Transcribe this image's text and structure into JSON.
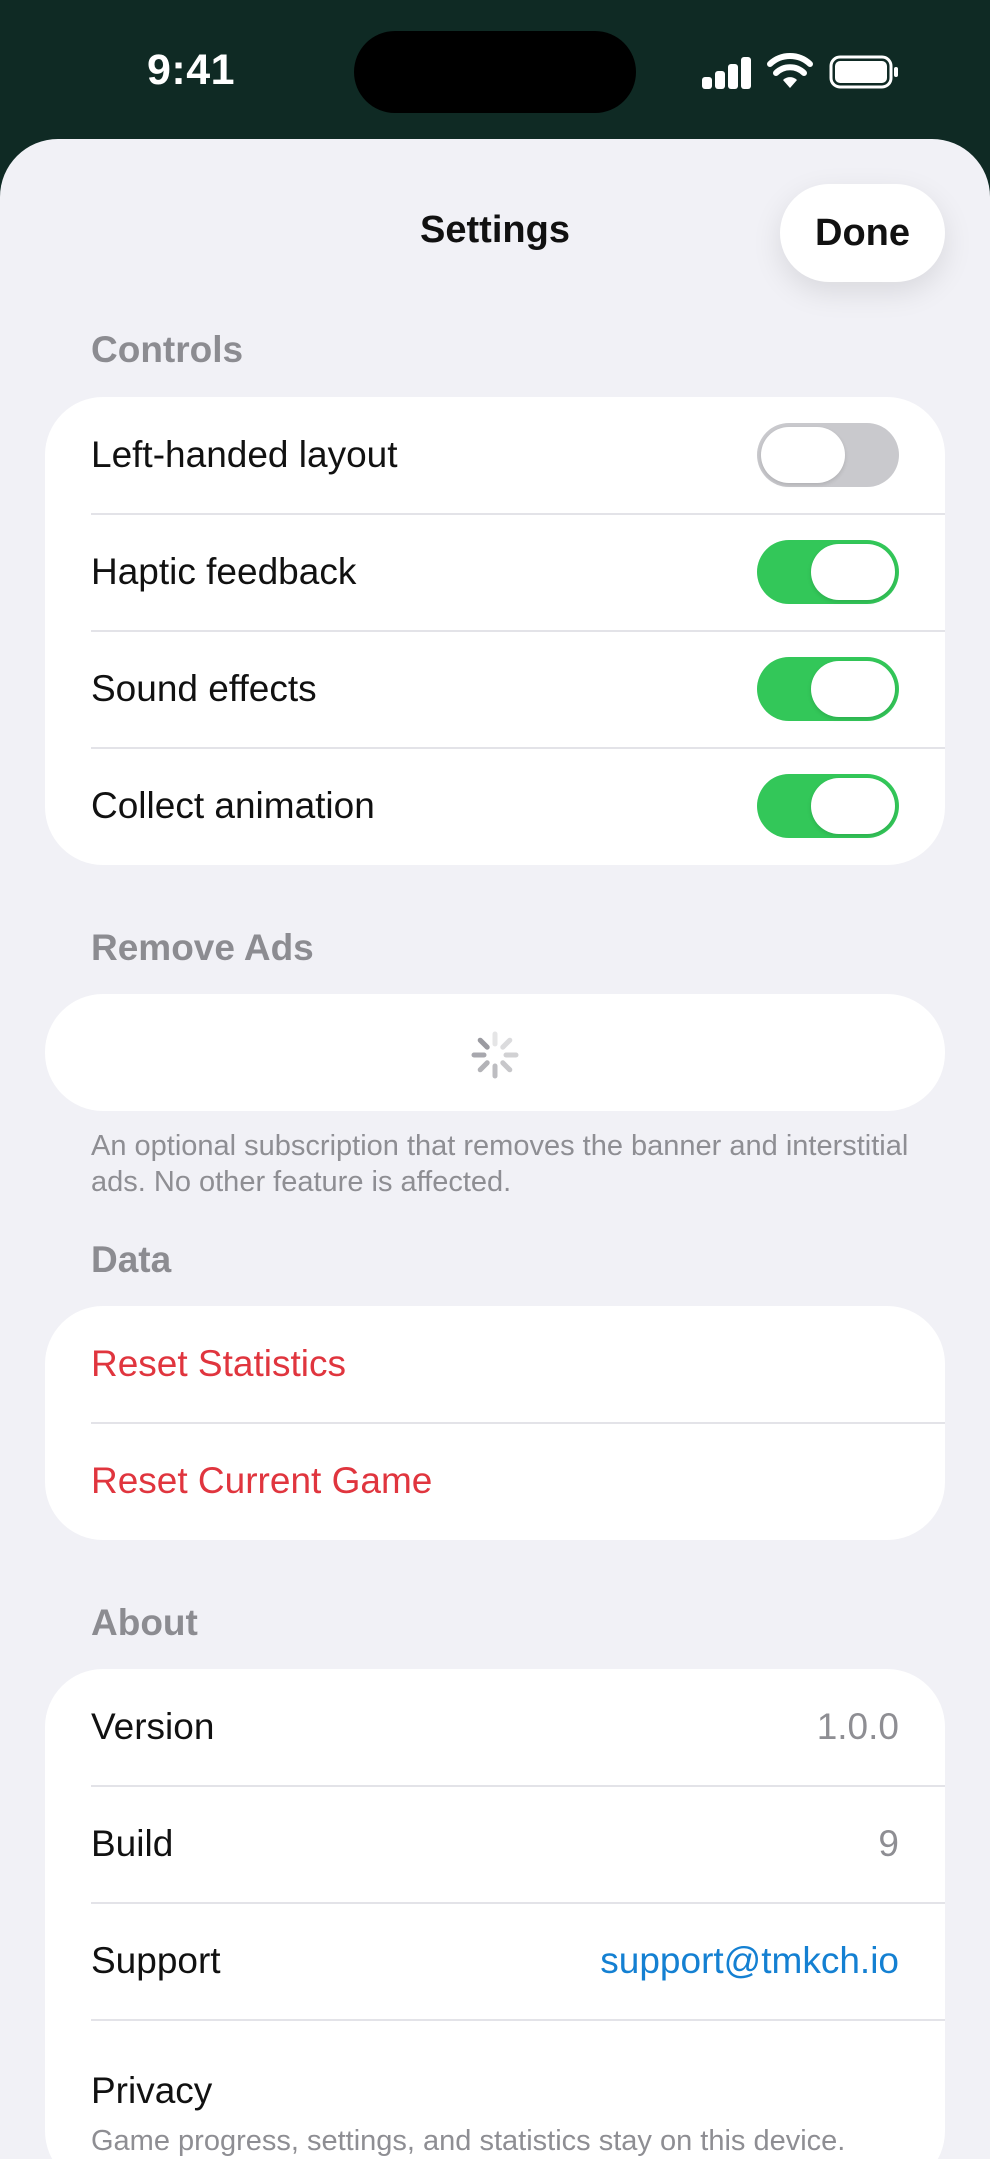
{
  "status_bar": {
    "time": "9:41"
  },
  "sheet": {
    "title": "Settings",
    "done_label": "Done"
  },
  "controls": {
    "header": "Controls",
    "items": [
      {
        "label": "Left-handed layout",
        "enabled": false
      },
      {
        "label": "Haptic feedback",
        "enabled": true
      },
      {
        "label": "Sound effects",
        "enabled": true
      },
      {
        "label": "Collect animation",
        "enabled": true
      }
    ]
  },
  "remove_ads": {
    "header": "Remove Ads",
    "footnote": "An optional subscription that removes the banner and interstitial ads. No other feature is affected."
  },
  "data_section": {
    "header": "Data",
    "items": [
      {
        "label": "Reset Statistics"
      },
      {
        "label": "Reset Current Game"
      }
    ]
  },
  "about": {
    "header": "About",
    "items": [
      {
        "label": "Version",
        "value": "1.0.0"
      },
      {
        "label": "Build",
        "value": "9"
      },
      {
        "label": "Support",
        "value": "support@tmkch.io"
      }
    ],
    "privacy": {
      "label": "Privacy",
      "description": "Game progress, settings, and statistics stay on this device."
    }
  },
  "colors": {
    "toggle_on": "#33c759",
    "toggle_off": "#c9c9cd",
    "destructive": "#e0353e",
    "link": "#1480d2",
    "status_bar_bg": "#0f2a24"
  }
}
